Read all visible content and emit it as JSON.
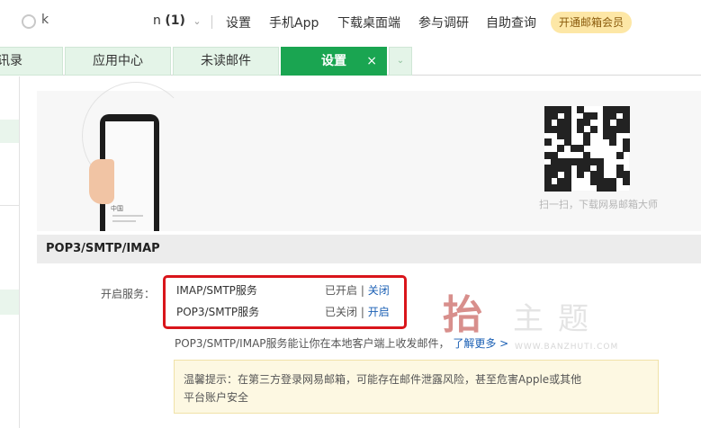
{
  "header": {
    "logo_text": "k",
    "mailbox_prefix": "n",
    "mailbox_count": "(1)",
    "links": [
      {
        "label": "设置"
      },
      {
        "label": "手机App"
      },
      {
        "label": "下载桌面端"
      },
      {
        "label": "参与调研"
      },
      {
        "label": "自助查询"
      }
    ],
    "vip_button": "开通邮箱会员"
  },
  "tabs": [
    {
      "label": "通讯录",
      "partial": "讯录"
    },
    {
      "label": "应用中心"
    },
    {
      "label": "未读邮件"
    },
    {
      "label": "设置",
      "active": true,
      "close": "×"
    }
  ],
  "promo": {
    "phone_text": "中国",
    "qr_caption": "扫一扫，下载网易邮箱大师"
  },
  "section": {
    "title": "POP3/SMTP/IMAP",
    "service_label": "开启服务：",
    "services": [
      {
        "name": "IMAP/SMTP服务",
        "status": "已开启",
        "separator": "|",
        "action": "关闭"
      },
      {
        "name": "POP3/SMTP服务",
        "status": "已关闭",
        "separator": "|",
        "action": "开启"
      }
    ],
    "description": "POP3/SMTP/IMAP服务能让你在本地客户端上收发邮件，",
    "learn_more": "了解更多 >",
    "warning_line1": "温馨提示：在第三方登录网易邮箱，可能存在邮件泄露风险，甚至危害Apple或其他",
    "warning_line2": "平台账户安全"
  },
  "watermark": {
    "chars": "主题",
    "url": "WWW.BANZHUTI.COM"
  },
  "colors": {
    "accent_green": "#1aa551",
    "highlight_red": "#d9151b",
    "link_blue": "#1a5fb4",
    "vip_yellow": "#fde7a6"
  }
}
